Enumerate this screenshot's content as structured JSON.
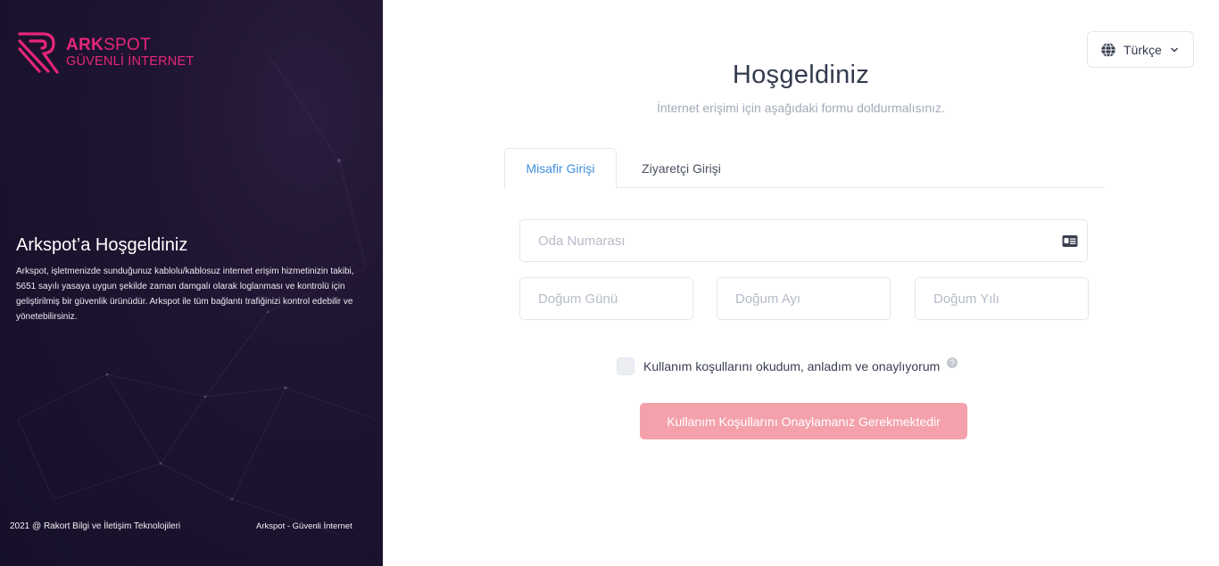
{
  "brand": {
    "name_bold": "ARK",
    "name_regular": "SPOT",
    "tagline": "GÜVENLİ İNTERNET",
    "accent_color": "#e6267a"
  },
  "sidebar": {
    "title": "Arkspot’a Hoşgeldiniz",
    "description": "Arkspot, işletmenizde sunduğunuz kablolu/kablosuz internet erişim hizmetinizin takibi, 5651 sayılı yasaya uygun şekilde zaman damgalı olarak loglanması ve kontrolü için geliştirilmiş bir güvenlik ürünüdür. Arkspot ile tüm bağlantı trafiğinizi kontrol edebilir ve yönetebilirsiniz.",
    "footer_copyright": "2021 @ Rakort Bilgi ve İletişim Teknolojileri",
    "footer_product": "Arkspot - Güvenli İnternet",
    "background_color": "#1e1430"
  },
  "language": {
    "selected": "Türkçe",
    "icon": "globe-icon"
  },
  "header": {
    "title": "Hoşgeldiniz",
    "subtitle": "İnternet erişimi için aşağıdaki formu doldurmalısınız."
  },
  "tabs": [
    {
      "label": "Misafir Girişi",
      "active": true
    },
    {
      "label": "Ziyaretçi Girişi",
      "active": false
    }
  ],
  "form": {
    "room_number": {
      "placeholder": "Oda Numarası",
      "value": "",
      "icon": "id-card-icon"
    },
    "birth_day": {
      "placeholder": "Doğum Günü",
      "value": ""
    },
    "birth_month": {
      "placeholder": "Doğum Ayı",
      "value": ""
    },
    "birth_year": {
      "placeholder": "Doğum Yılı",
      "value": ""
    },
    "terms_label": "Kullanım koşullarını okudum, anladım ve onaylıyorum",
    "terms_checked": false,
    "help_glyph": "?",
    "submit_label": "Kullanım Koşullarını Onaylamanız Gerekmektedir",
    "submit_color": "#f4a1ab"
  },
  "colors": {
    "tab_active_text": "#3f8ee0",
    "title_text": "#333a4d"
  }
}
